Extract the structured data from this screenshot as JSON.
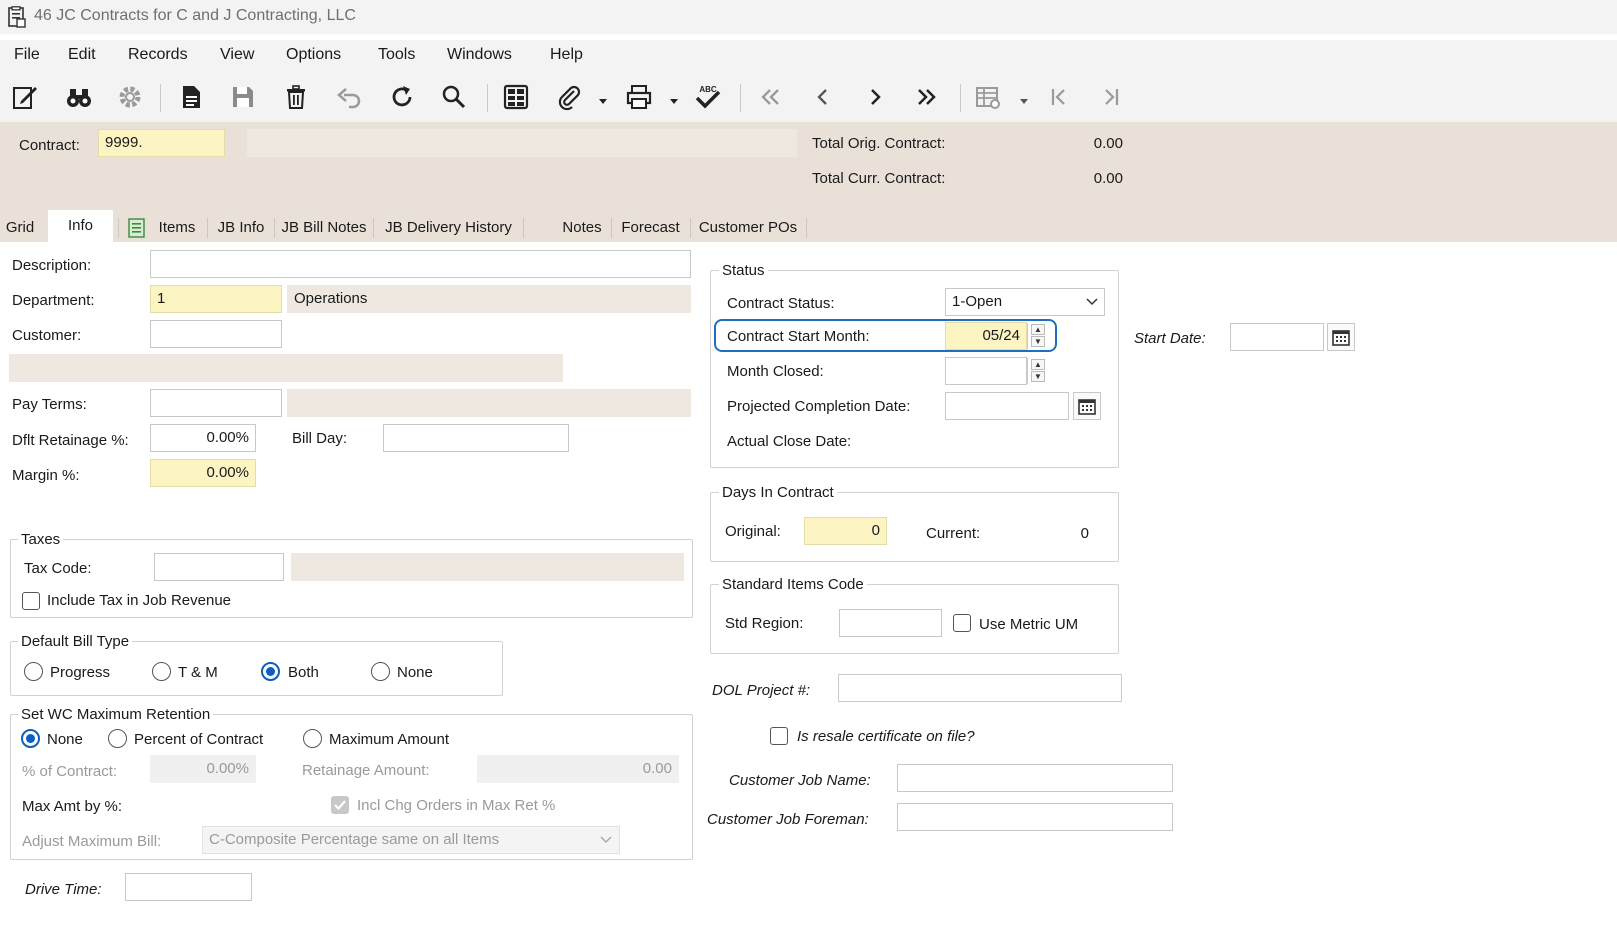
{
  "window": {
    "title": "46 JC Contracts for C and J Contracting, LLC"
  },
  "menu": [
    "File",
    "Edit",
    "Records",
    "View",
    "Options",
    "Tools",
    "Windows",
    "Help"
  ],
  "toolbar": {
    "icons": [
      "edit-form-icon",
      "binoculars-icon",
      "settings-gear-icon",
      "new-document-icon",
      "save-icon",
      "delete-trash-icon",
      "undo-icon",
      "refresh-icon",
      "search-icon",
      "grid-layout-icon",
      "attachment-icon",
      "print-icon",
      "spellcheck-icon",
      "first-record-icon",
      "previous-record-icon",
      "next-record-icon",
      "last-record-icon",
      "table-settings-icon",
      "first-page-icon",
      "last-page-icon"
    ],
    "spellcheck_abc": "ABC"
  },
  "header": {
    "contract_label": "Contract:",
    "contract_value": "9999.",
    "contract_desc": "",
    "total_orig_label": "Total Orig. Contract:",
    "total_orig_value": "0.00",
    "total_curr_label": "Total Curr. Contract:",
    "total_curr_value": "0.00"
  },
  "tabs": [
    "Grid",
    "Info",
    "Items",
    "JB Info",
    "JB Bill Notes",
    "JB Delivery History",
    "Notes",
    "Forecast",
    "Customer POs"
  ],
  "active_tab": "Info",
  "info": {
    "description_label": "Description:",
    "description_value": "",
    "department_label": "Department:",
    "department_value": "1",
    "department_name": "Operations",
    "customer_label": "Customer:",
    "customer_value": "",
    "pay_terms_label": "Pay Terms:",
    "pay_terms_value": "",
    "retainage_label": "Dflt Retainage %:",
    "retainage_value": "0.00%",
    "bill_day_label": "Bill Day:",
    "bill_day_value": "",
    "margin_label": "Margin %:",
    "margin_value": "0.00%"
  },
  "taxes": {
    "title": "Taxes",
    "tax_code_label": "Tax Code:",
    "tax_code_value": "",
    "include_tax_label": "Include Tax in Job Revenue",
    "include_tax_checked": false
  },
  "bill_type": {
    "title": "Default Bill Type",
    "options": [
      "Progress",
      "T & M",
      "Both",
      "None"
    ],
    "selected": "Both"
  },
  "wc_retention": {
    "title": "Set WC Maximum Retention",
    "options": [
      "None",
      "Percent of Contract",
      "Maximum Amount"
    ],
    "selected": "None",
    "pct_contract_label": "% of Contract:",
    "pct_contract_value": "0.00%",
    "retainage_amount_label": "Retainage Amount:",
    "retainage_amount_value": "0.00",
    "max_amt_label": "Max Amt by %:",
    "incl_chg_label": "Incl Chg Orders in Max Ret %",
    "incl_chg_checked": true,
    "adjust_label": "Adjust Maximum Bill:",
    "adjust_value": "C-Composite Percentage same on all Items"
  },
  "drive_time": {
    "label": "Drive Time:",
    "value": ""
  },
  "status": {
    "title": "Status",
    "contract_status_label": "Contract Status:",
    "contract_status_value": "1-Open",
    "start_month_label": "Contract Start Month:",
    "start_month_value": "05/24",
    "month_closed_label": "Month Closed:",
    "month_closed_value": "",
    "projected_label": "Projected Completion Date:",
    "projected_value": "",
    "actual_close_label": "Actual Close Date:"
  },
  "start_date": {
    "label": "Start Date:",
    "value": ""
  },
  "days": {
    "title": "Days In Contract",
    "original_label": "Original:",
    "original_value": "0",
    "current_label": "Current:",
    "current_value": "0"
  },
  "std_items": {
    "title": "Standard Items Code",
    "region_label": "Std Region:",
    "region_value": "",
    "metric_label": "Use Metric UM",
    "metric_checked": false
  },
  "dol": {
    "label": "DOL Project #:",
    "value": ""
  },
  "resale": {
    "label": "Is resale certificate on file?",
    "checked": false
  },
  "customer_job": {
    "name_label": "Customer Job Name:",
    "name_value": "",
    "foreman_label": "Customer Job Foreman:",
    "foreman_value": ""
  },
  "colors": {
    "accent": "#1f6fc0",
    "header_bg": "#e9e0d8",
    "required_bg": "#fdf4c4"
  }
}
